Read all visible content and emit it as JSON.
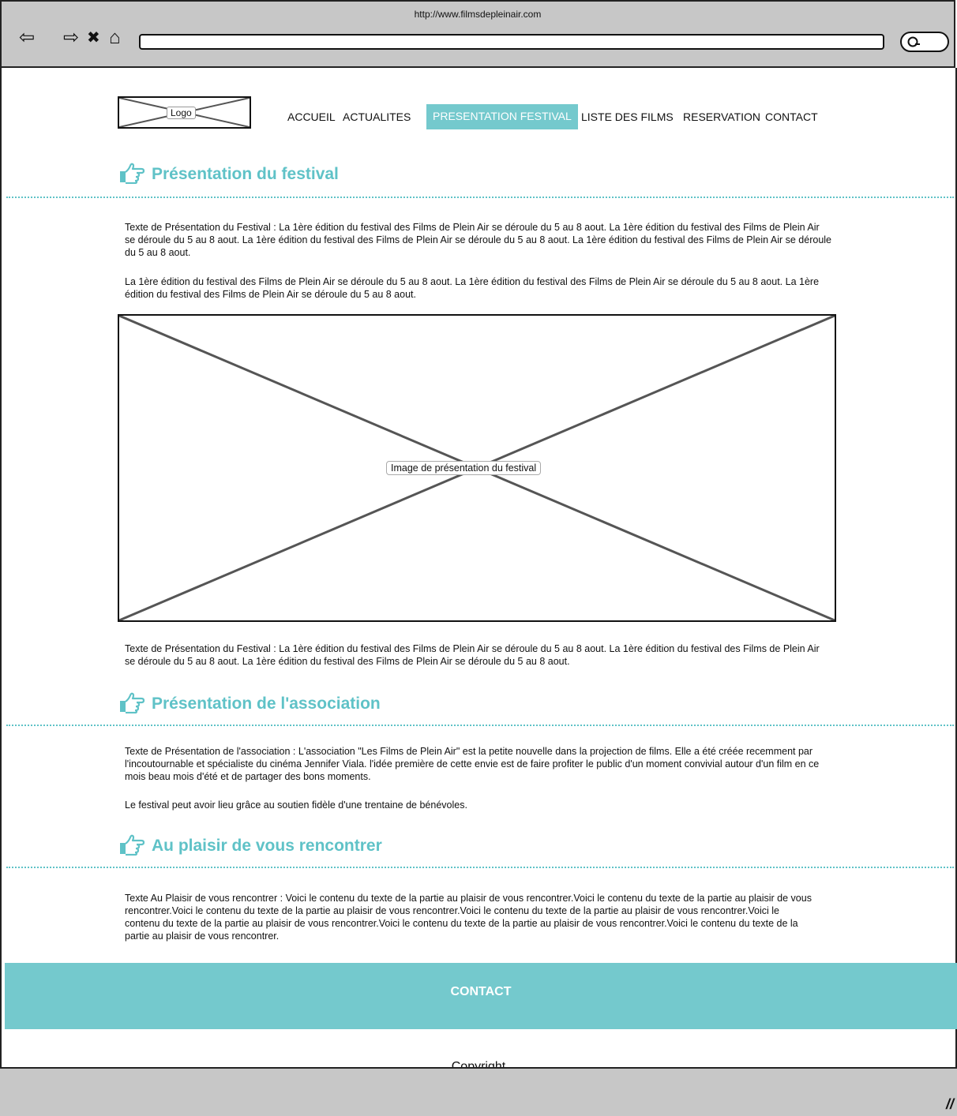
{
  "browser": {
    "url": "http://www.filmsdepleinair.com",
    "controls": {
      "back": "⇦",
      "forward": "⇨",
      "stop": "✖",
      "home": "⌂"
    }
  },
  "header": {
    "logo_label": "Logo",
    "nav": [
      {
        "label": "ACCUEIL",
        "active": false
      },
      {
        "label": "ACTUALITES",
        "active": false
      },
      {
        "label": "PRESENTATION FESTIVAL",
        "active": true
      },
      {
        "label": "LISTE DES FILMS",
        "active": false
      },
      {
        "label": "RESERVATION",
        "active": false
      },
      {
        "label": "CONTACT",
        "active": false
      }
    ]
  },
  "sections": {
    "festival": {
      "title": "Présentation du festival",
      "intro_1": "Texte de Présentation du Festival : La 1ère édition du festival des Films de Plein Air se déroule du 5 au 8 aout. La 1ère édition du festival des Films de Plein Air se déroule du 5 au 8 aout. La 1ère édition du festival des Films de Plein Air se déroule du 5 au 8 aout. La 1ère édition du festival des Films de Plein Air se déroule du 5 au 8 aout.",
      "intro_2": "La 1ère édition du festival des Films de Plein Air se déroule du 5 au 8 aout. La 1ère édition du festival des Films de Plein Air se déroule du 5 au 8 aout. La 1ère édition du festival des Films de Plein Air se déroule du 5 au 8 aout.",
      "image_label": "Image de présentation du festival",
      "outro": "Texte de Présentation du Festival : La 1ère édition du festival des Films de Plein Air se déroule du 5 au 8 aout. La 1ère édition du festival des Films de Plein Air se déroule du 5 au 8 aout. La 1ère édition du festival des Films de Plein Air se déroule du 5 au 8 aout."
    },
    "association": {
      "title": "Présentation de l'association",
      "text_1": "Texte de Présentation de l'association : L'association \"Les Films de Plein Air\" est la petite nouvelle dans la projection de films. Elle a été créée recemment par l'incoutournable et spécialiste du cinéma Jennifer Viala. l'idée première de cette envie est de faire profiter le public d'un moment convivial autour d'un film en ce mois beau mois d'été et de partager des bons moments.",
      "text_2": "Le festival peut avoir lieu grâce au soutien fidèle d'une trentaine de bénévoles."
    },
    "rencontre": {
      "title": "Au plaisir de vous rencontrer",
      "text": "Texte Au Plaisir de vous rencontrer : Voici le contenu du texte de la partie au plaisir de vous rencontrer.Voici le contenu du texte de la partie au plaisir de vous rencontrer.Voici le contenu du texte de la partie au plaisir de vous rencontrer.Voici le contenu du texte de la partie au plaisir de vous rencontrer.Voici le contenu du texte de la partie au plaisir de vous rencontrer.Voici le contenu du texte de la partie au plaisir de vous rencontrer.Voici le contenu du texte de la partie au plaisir de vous rencontrer."
    }
  },
  "footer": {
    "contact_label": "CONTACT",
    "copyright": "Copyright"
  },
  "colors": {
    "accent": "#74c9cd",
    "title": "#5fc2c7",
    "chrome": "#c7c7c7"
  },
  "icons": [
    "back-arrow-icon",
    "forward-arrow-icon",
    "stop-icon",
    "home-icon",
    "search-icon",
    "pointing-hand-icon",
    "resize-grip-icon"
  ]
}
